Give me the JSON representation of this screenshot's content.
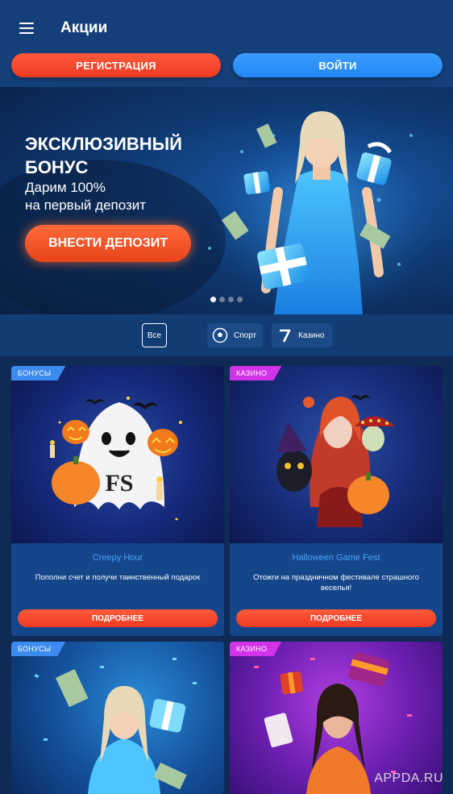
{
  "header": {
    "title": "Акции",
    "register_label": "РЕГИСТРАЦИЯ",
    "login_label": "ВОЙТИ"
  },
  "banner": {
    "title": "ЭКСКЛЮЗИВНЫЙ БОНУС",
    "subtitle_line1": "Дарим 100%",
    "subtitle_line2": "на первый депозит",
    "button_label": "ВНЕСТИ ДЕПОЗИТ",
    "slide_count": 4,
    "active_slide": 1
  },
  "filters": {
    "all": "Все",
    "sport": "Спорт",
    "casino": "Казино"
  },
  "cards": [
    {
      "tag": "БОНУСЫ",
      "title": "Creepy Hour",
      "description": "Пополни счет и получи таинственный подарок",
      "button": "ПОДРОБНЕЕ"
    },
    {
      "tag": "КАЗИНО",
      "title": "Halloween Game Fest",
      "description": "Отожги на праздничном фестивале страшного веселья!",
      "button": "ПОДРОБНЕЕ"
    },
    {
      "tag": "БОНУСЫ"
    },
    {
      "tag": "КАЗИНО"
    }
  ],
  "artwork": {
    "ghost_label": "FS"
  },
  "watermark": "APPDA.RU",
  "colors": {
    "accent_orange": "#f03a22",
    "accent_blue": "#2187f5",
    "header_bg": "#153f78",
    "tag_bonus": "#3c8bf0",
    "tag_casino": "#d233e8",
    "card_title": "#4aa3ff"
  }
}
